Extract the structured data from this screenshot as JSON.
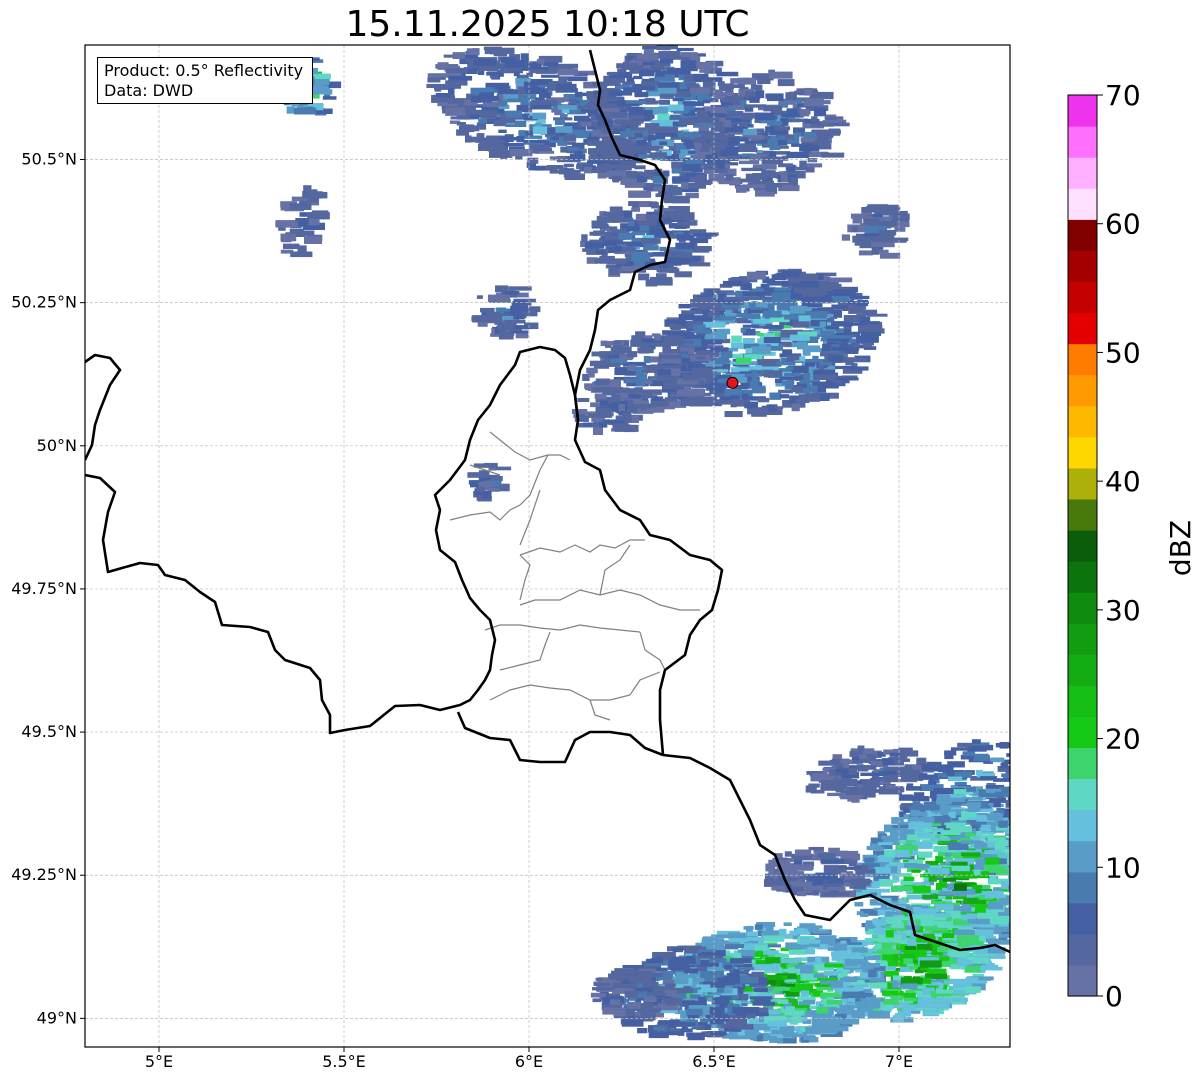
{
  "title": "15.11.2025 10:18 UTC",
  "info": {
    "product": "Product: 0.5° Reflectivity",
    "data": "Data: DWD"
  },
  "map": {
    "lon_range": [
      4.8,
      7.3
    ],
    "lat_range": [
      48.95,
      50.7
    ],
    "lon_ticks": [
      {
        "value": 5.0,
        "label": "5°E"
      },
      {
        "value": 5.5,
        "label": "5.5°E"
      },
      {
        "value": 6.0,
        "label": "6°E"
      },
      {
        "value": 6.5,
        "label": "6.5°E"
      },
      {
        "value": 7.0,
        "label": "7°E"
      }
    ],
    "lat_ticks": [
      {
        "value": 49.0,
        "label": "49°N"
      },
      {
        "value": 49.25,
        "label": "49.25°N"
      },
      {
        "value": 49.5,
        "label": "49.5°N"
      },
      {
        "value": 49.75,
        "label": "49.75°N"
      },
      {
        "value": 50.0,
        "label": "50°N"
      },
      {
        "value": 50.25,
        "label": "50.25°N"
      },
      {
        "value": 50.5,
        "label": "50.5°N"
      }
    ],
    "gridlines": true,
    "radar_site": {
      "lon": 6.55,
      "lat": 50.11,
      "color": "#e4151c"
    },
    "border_color": "#000000",
    "admin_border_color": "#808080"
  },
  "colorbar": {
    "label": "dBZ",
    "min": 0,
    "max": 70,
    "tick_values": [
      0,
      10,
      20,
      30,
      40,
      50,
      60,
      70
    ],
    "tick_labels": [
      "0",
      "10",
      "20",
      "30",
      "40",
      "50",
      "60",
      "70"
    ],
    "colors": [
      "#6672a6",
      "#54679f",
      "#4460a3",
      "#4a7bb0",
      "#5a9cc8",
      "#64c0dd",
      "#5fd7c5",
      "#3dd46d",
      "#16c916",
      "#14be14",
      "#13ad13",
      "#119c11",
      "#0f8b0f",
      "#0c740c",
      "#0a5e0a",
      "#477a0b",
      "#aeb00a",
      "#ffd700",
      "#ffb800",
      "#ff9a00",
      "#ff7c00",
      "#e40000",
      "#c50000",
      "#a40000",
      "#800000",
      "#ffe1ff",
      "#ffb1ff",
      "#ff70ff",
      "#ee32ee"
    ]
  },
  "chart_data": {
    "type": "heatmap",
    "title": "15.11.2025 10:18 UTC",
    "xlabel": "",
    "ylabel": "",
    "xlim": [
      4.8,
      7.3
    ],
    "ylim": [
      48.95,
      50.7
    ],
    "colorbar_label": "dBZ",
    "colorbar_range": [
      0,
      70
    ],
    "echo_regions": [
      {
        "name": "north",
        "lon_range": [
          5.75,
          6.9
        ],
        "lat_range": [
          50.2,
          50.7
        ],
        "max_dbz": 22
      },
      {
        "name": "around-radar",
        "lon_range": [
          6.3,
          7.0
        ],
        "lat_range": [
          50.0,
          50.35
        ],
        "max_dbz": 22
      },
      {
        "name": "south-east",
        "lon_range": [
          6.2,
          7.3
        ],
        "lat_range": [
          48.95,
          49.5
        ],
        "max_dbz": 32
      }
    ]
  }
}
